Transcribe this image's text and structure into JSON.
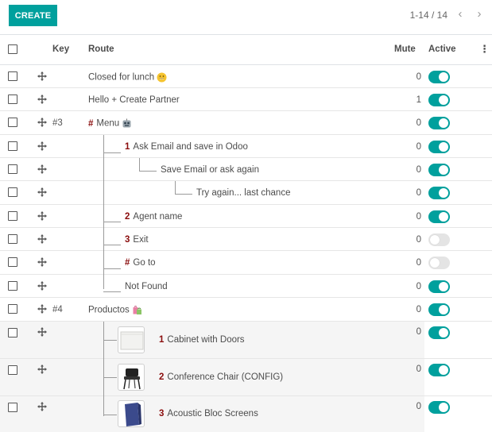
{
  "toolbar": {
    "create_label": "CREATE"
  },
  "pager": {
    "text": "1-14 / 14",
    "prev": "‹",
    "next": "›"
  },
  "columns": {
    "key": "Key",
    "route": "Route",
    "mute": "Mute",
    "active": "Active",
    "options": "⋮"
  },
  "rows": [
    {
      "key": "",
      "route": "Closed for lunch",
      "mute": "0",
      "active": true
    },
    {
      "key": "",
      "route": "Hello + Create Partner",
      "mute": "1",
      "active": true
    },
    {
      "key": "#3",
      "num": "#",
      "route": "Menu",
      "mute": "0",
      "active": true
    },
    {
      "key": "",
      "num": "1",
      "route": "Ask Email and save in Odoo",
      "mute": "0",
      "active": true
    },
    {
      "key": "",
      "route": "Save Email or ask again",
      "mute": "0",
      "active": true
    },
    {
      "key": "",
      "route": "Try again... last chance",
      "mute": "0",
      "active": true
    },
    {
      "key": "",
      "num": "2",
      "route": "Agent name",
      "mute": "0",
      "active": true
    },
    {
      "key": "",
      "num": "3",
      "route": "Exit",
      "mute": "0",
      "active": false
    },
    {
      "key": "",
      "num": "#",
      "route": "Go to",
      "mute": "0",
      "active": false
    },
    {
      "key": "",
      "route": "Not Found",
      "mute": "0",
      "active": true
    },
    {
      "key": "#4",
      "route": "Productos",
      "mute": "0",
      "active": true
    },
    {
      "key": "",
      "num": "1",
      "route": "Cabinet with Doors",
      "mute": "0",
      "active": true,
      "thumb": "cabinet"
    },
    {
      "key": "",
      "num": "2",
      "route": "Conference Chair (CONFIG)",
      "mute": "0",
      "active": true,
      "thumb": "chair"
    },
    {
      "key": "",
      "num": "3",
      "route": "Acoustic Bloc Screens",
      "mute": "0",
      "active": true,
      "thumb": "screen"
    }
  ],
  "colors": {
    "accent": "#00a09d",
    "number": "#8a0c0c",
    "toggle_off": "#e4e4e4"
  },
  "icons": {
    "handle": "move-handle-icon",
    "lunch_emoji": "smiling-face-icon",
    "menu_emoji": "robot-face-icon",
    "products_emoji": "shopping-bags-icon"
  }
}
